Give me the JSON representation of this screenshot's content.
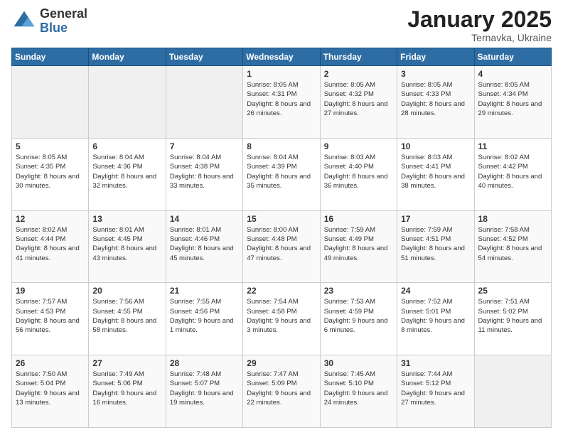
{
  "header": {
    "logo_general": "General",
    "logo_blue": "Blue",
    "month_title": "January 2025",
    "subtitle": "Ternavka, Ukraine"
  },
  "weekdays": [
    "Sunday",
    "Monday",
    "Tuesday",
    "Wednesday",
    "Thursday",
    "Friday",
    "Saturday"
  ],
  "weeks": [
    [
      {
        "day": "",
        "info": ""
      },
      {
        "day": "",
        "info": ""
      },
      {
        "day": "",
        "info": ""
      },
      {
        "day": "1",
        "info": "Sunrise: 8:05 AM\nSunset: 4:31 PM\nDaylight: 8 hours\nand 26 minutes."
      },
      {
        "day": "2",
        "info": "Sunrise: 8:05 AM\nSunset: 4:32 PM\nDaylight: 8 hours\nand 27 minutes."
      },
      {
        "day": "3",
        "info": "Sunrise: 8:05 AM\nSunset: 4:33 PM\nDaylight: 8 hours\nand 28 minutes."
      },
      {
        "day": "4",
        "info": "Sunrise: 8:05 AM\nSunset: 4:34 PM\nDaylight: 8 hours\nand 29 minutes."
      }
    ],
    [
      {
        "day": "5",
        "info": "Sunrise: 8:05 AM\nSunset: 4:35 PM\nDaylight: 8 hours\nand 30 minutes."
      },
      {
        "day": "6",
        "info": "Sunrise: 8:04 AM\nSunset: 4:36 PM\nDaylight: 8 hours\nand 32 minutes."
      },
      {
        "day": "7",
        "info": "Sunrise: 8:04 AM\nSunset: 4:38 PM\nDaylight: 8 hours\nand 33 minutes."
      },
      {
        "day": "8",
        "info": "Sunrise: 8:04 AM\nSunset: 4:39 PM\nDaylight: 8 hours\nand 35 minutes."
      },
      {
        "day": "9",
        "info": "Sunrise: 8:03 AM\nSunset: 4:40 PM\nDaylight: 8 hours\nand 36 minutes."
      },
      {
        "day": "10",
        "info": "Sunrise: 8:03 AM\nSunset: 4:41 PM\nDaylight: 8 hours\nand 38 minutes."
      },
      {
        "day": "11",
        "info": "Sunrise: 8:02 AM\nSunset: 4:42 PM\nDaylight: 8 hours\nand 40 minutes."
      }
    ],
    [
      {
        "day": "12",
        "info": "Sunrise: 8:02 AM\nSunset: 4:44 PM\nDaylight: 8 hours\nand 41 minutes."
      },
      {
        "day": "13",
        "info": "Sunrise: 8:01 AM\nSunset: 4:45 PM\nDaylight: 8 hours\nand 43 minutes."
      },
      {
        "day": "14",
        "info": "Sunrise: 8:01 AM\nSunset: 4:46 PM\nDaylight: 8 hours\nand 45 minutes."
      },
      {
        "day": "15",
        "info": "Sunrise: 8:00 AM\nSunset: 4:48 PM\nDaylight: 8 hours\nand 47 minutes."
      },
      {
        "day": "16",
        "info": "Sunrise: 7:59 AM\nSunset: 4:49 PM\nDaylight: 8 hours\nand 49 minutes."
      },
      {
        "day": "17",
        "info": "Sunrise: 7:59 AM\nSunset: 4:51 PM\nDaylight: 8 hours\nand 51 minutes."
      },
      {
        "day": "18",
        "info": "Sunrise: 7:58 AM\nSunset: 4:52 PM\nDaylight: 8 hours\nand 54 minutes."
      }
    ],
    [
      {
        "day": "19",
        "info": "Sunrise: 7:57 AM\nSunset: 4:53 PM\nDaylight: 8 hours\nand 56 minutes."
      },
      {
        "day": "20",
        "info": "Sunrise: 7:56 AM\nSunset: 4:55 PM\nDaylight: 8 hours\nand 58 minutes."
      },
      {
        "day": "21",
        "info": "Sunrise: 7:55 AM\nSunset: 4:56 PM\nDaylight: 9 hours\nand 1 minute."
      },
      {
        "day": "22",
        "info": "Sunrise: 7:54 AM\nSunset: 4:58 PM\nDaylight: 9 hours\nand 3 minutes."
      },
      {
        "day": "23",
        "info": "Sunrise: 7:53 AM\nSunset: 4:59 PM\nDaylight: 9 hours\nand 6 minutes."
      },
      {
        "day": "24",
        "info": "Sunrise: 7:52 AM\nSunset: 5:01 PM\nDaylight: 9 hours\nand 8 minutes."
      },
      {
        "day": "25",
        "info": "Sunrise: 7:51 AM\nSunset: 5:02 PM\nDaylight: 9 hours\nand 11 minutes."
      }
    ],
    [
      {
        "day": "26",
        "info": "Sunrise: 7:50 AM\nSunset: 5:04 PM\nDaylight: 9 hours\nand 13 minutes."
      },
      {
        "day": "27",
        "info": "Sunrise: 7:49 AM\nSunset: 5:06 PM\nDaylight: 9 hours\nand 16 minutes."
      },
      {
        "day": "28",
        "info": "Sunrise: 7:48 AM\nSunset: 5:07 PM\nDaylight: 9 hours\nand 19 minutes."
      },
      {
        "day": "29",
        "info": "Sunrise: 7:47 AM\nSunset: 5:09 PM\nDaylight: 9 hours\nand 22 minutes."
      },
      {
        "day": "30",
        "info": "Sunrise: 7:45 AM\nSunset: 5:10 PM\nDaylight: 9 hours\nand 24 minutes."
      },
      {
        "day": "31",
        "info": "Sunrise: 7:44 AM\nSunset: 5:12 PM\nDaylight: 9 hours\nand 27 minutes."
      },
      {
        "day": "",
        "info": ""
      }
    ]
  ]
}
